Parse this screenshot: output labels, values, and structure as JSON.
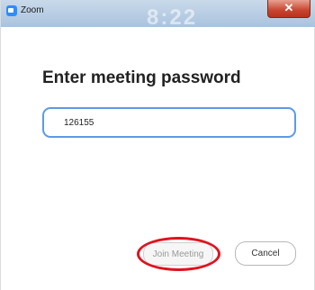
{
  "window": {
    "title": "Zoom",
    "background_clock_text": "8:22",
    "close_glyph": "✕"
  },
  "dialog": {
    "heading": "Enter meeting password",
    "password_value": "126155"
  },
  "buttons": {
    "join_label": "Join Meeting",
    "cancel_label": "Cancel"
  },
  "icons": {
    "app": "zoom-app-icon",
    "close": "close-icon"
  },
  "colors": {
    "input_border": "#5b9be5",
    "annotation_circle": "#e0121e",
    "close_button": "#c8452f"
  }
}
